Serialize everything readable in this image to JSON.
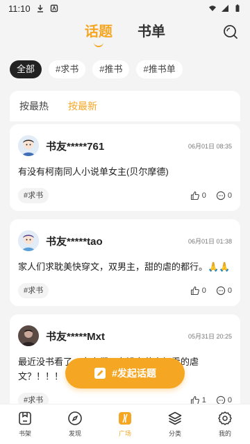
{
  "status_bar": {
    "time": "11:10"
  },
  "header": {
    "tabs": [
      {
        "label": "话题"
      },
      {
        "label": "书单"
      }
    ]
  },
  "filters": [
    {
      "label": "全部"
    },
    {
      "label": "#求书"
    },
    {
      "label": "#推书"
    },
    {
      "label": "#推书单"
    }
  ],
  "sort": [
    {
      "label": "按最热"
    },
    {
      "label": "按最新"
    }
  ],
  "posts": [
    {
      "user": "书友*****761",
      "time": "06月01日 08:35",
      "body": "有没有柯南同人小说单女主(贝尔摩德)",
      "tag": "#求书",
      "likes": "0",
      "comments": "0"
    },
    {
      "user": "书友*****tao",
      "time": "06月01日 01:38",
      "body": "家人们求耽美快穿文，双男主，甜的虐的都行。🙏🙏",
      "tag": "#求书",
      "likes": "0",
      "comments": "0"
    },
    {
      "user": "书友*****Mxt",
      "time": "05月31日 20:25",
      "body": "最近没书看了，家人们，有没有什么好看的虐文？！！！",
      "tag": "#求书",
      "likes": "1",
      "comments": "0"
    }
  ],
  "fab": {
    "label": "#发起话题"
  },
  "bottom_nav": [
    {
      "label": "书架",
      "icon": "bookshelf-icon"
    },
    {
      "label": "发现",
      "icon": "compass-icon"
    },
    {
      "label": "广场",
      "icon": "plaza-icon"
    },
    {
      "label": "分类",
      "icon": "layers-icon"
    },
    {
      "label": "我的",
      "icon": "gear-icon"
    }
  ],
  "colors": {
    "accent": "#f5a623",
    "background": "#f4f4f4"
  }
}
